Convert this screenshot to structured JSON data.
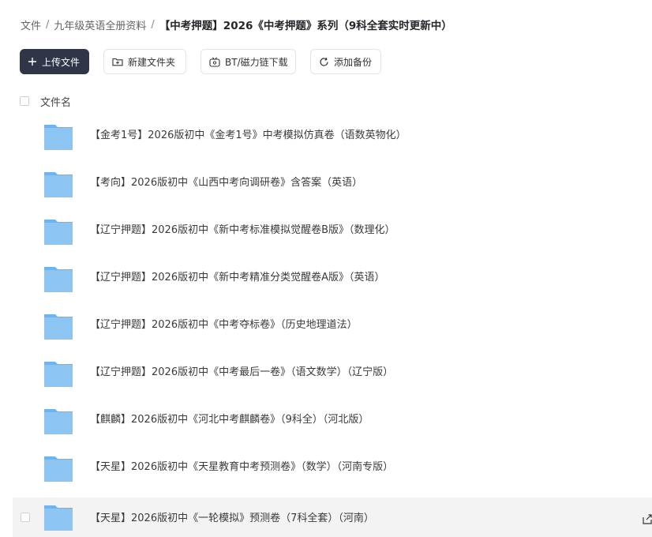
{
  "breadcrumb": {
    "root": "文件",
    "parent": "九年级英语全册资料",
    "current": "【中考押题】2026《中考押题》系列（9科全套实时更新中）"
  },
  "toolbar": {
    "upload_label": "上传文件",
    "new_folder_label": "新建文件夹",
    "bt_download_label": "BT/磁力链下载",
    "add_backup_label": "添加备份"
  },
  "list": {
    "header_label": "文件名",
    "items": [
      {
        "name": "【金考1号】2026版初中《金考1号》中考模拟仿真卷（语数英物化）"
      },
      {
        "name": "【考向】2026版初中《山西中考向调研卷》含答案（英语）"
      },
      {
        "name": "【辽宁押题】2026版初中《新中考标准模拟觉醒卷B版》（数理化）"
      },
      {
        "name": "【辽宁押题】2026版初中《新中考精准分类觉醒卷A版》（英语）"
      },
      {
        "name": "【辽宁押题】2026版初中《中考夺标卷》（历史地理道法）"
      },
      {
        "name": "【辽宁押题】2026版初中《中考最后一卷》（语文数学）（辽宁版）"
      },
      {
        "name": "【麒麟】2026版初中《河北中考麒麟卷》（9科全）（河北版）"
      },
      {
        "name": "【天星】2026版初中《天星教育中考预测卷》（数学）（河南专版）"
      },
      {
        "name": "【天星】2026版初中《一轮模拟》预测卷（7科全套）（河南）"
      }
    ]
  },
  "colors": {
    "primary_button": "#303547",
    "folder_blue": "#8cc4f2",
    "folder_tab": "#6fb2ec",
    "hover_row": "#f3f3f4"
  },
  "icons": {
    "upload": "plus-icon",
    "new_folder": "folder-plus-icon",
    "bt": "magnet-icon",
    "backup": "refresh-icon",
    "folder": "folder-icon",
    "share": "share-icon"
  }
}
